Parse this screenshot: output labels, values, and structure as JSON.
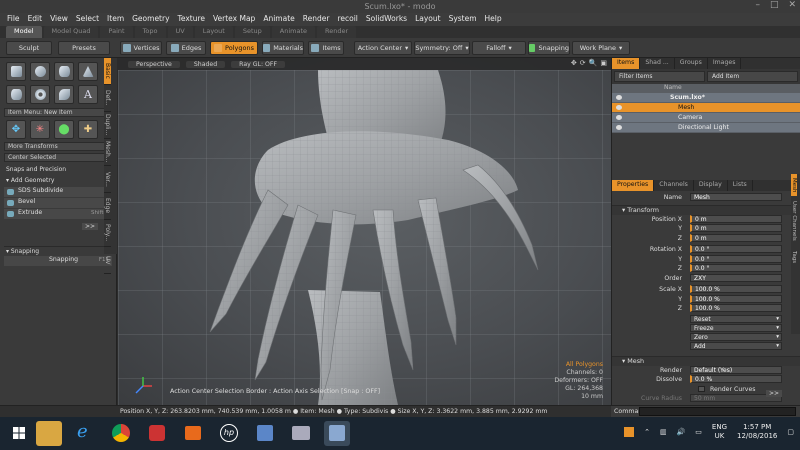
{
  "window": {
    "title": "Scum.lxo* - modo",
    "controls": [
      "–",
      "□",
      "✕"
    ]
  },
  "menu": [
    "File",
    "Edit",
    "View",
    "Select",
    "Item",
    "Geometry",
    "Texture",
    "Vertex Map",
    "Animate",
    "Render",
    "recoil",
    "SolidWorks",
    "Layout",
    "System",
    "Help"
  ],
  "layout_tabs": [
    "Model",
    "Model Quad",
    "Paint",
    "Topo",
    "UV",
    "Layout",
    "Setup",
    "Animate",
    "Render"
  ],
  "toolbar": {
    "sculpt": "Sculpt",
    "presets": "Presets",
    "vertices": "Vertices",
    "edges": "Edges",
    "polygons": "Polygons",
    "materials": "Materials",
    "items": "Items",
    "action_center": "Action Center",
    "symmetry": "Symmetry: Off",
    "falloff": "Falloff",
    "snapping": "Snapping",
    "work_plane": "Work Plane"
  },
  "left": {
    "item_menu": "Item Menu: New Item",
    "more_transforms": "More Transforms",
    "center_selected": "Center Selected",
    "snaps_section": "Snaps and Precision",
    "add_geometry": "Add Geometry",
    "items": [
      {
        "label": "SDS Subdivide",
        "shortcut": "D"
      },
      {
        "label": "Bevel",
        "shortcut": "B"
      },
      {
        "label": "Extrude",
        "shortcut": "Shift-X"
      }
    ],
    "more": ">>",
    "snapping_title": "Snapping",
    "snapping_btn": "Snapping",
    "snapping_key": "F11",
    "side_tabs": [
      "Basic",
      "Def...",
      "Dupli...",
      "Mesh...",
      "Ver...",
      "Edge",
      "Poly...",
      "UV"
    ]
  },
  "viewport": {
    "tabs": [
      "Perspective",
      "Shaded",
      "Ray GL: OFF"
    ],
    "hint": "Action Center Selection Border : Action Axis Selection  [Snap : OFF]",
    "status": {
      "mode": "All Polygons",
      "channels": "Channels: 0",
      "deformers": "Deformers: OFF",
      "gl": "GL: 264,368",
      "scale": "10 mm"
    }
  },
  "items_panel": {
    "tabs": [
      "Items",
      "Shad ...",
      "Groups",
      "Images"
    ],
    "filter": "Filter Items",
    "add_item": "Add Item",
    "header": "Name",
    "tree": [
      "Scum.lxo*",
      "Mesh",
      "Camera",
      "Directional Light"
    ]
  },
  "props_panel": {
    "tabs": [
      "Properties",
      "Channels",
      "Display",
      "Lists"
    ],
    "name_label": "Name",
    "name_value": "Mesh",
    "transform_title": "Transform",
    "position": {
      "label": "Position X",
      "y": "Y",
      "z": "Z",
      "x_val": "0 m",
      "y_val": "0 m",
      "z_val": "0 m"
    },
    "rotation": {
      "label": "Rotation X",
      "x_val": "0.0 °",
      "y_val": "0.0 °",
      "z_val": "0.0 °"
    },
    "order": {
      "label": "Order",
      "value": "ZXY"
    },
    "scale": {
      "label": "Scale X",
      "x_val": "100.0 %",
      "y_val": "100.0 %",
      "z_val": "100.0 %"
    },
    "actions": [
      "Reset",
      "Freeze",
      "Zero",
      "Add"
    ],
    "mesh_title": "Mesh",
    "render": {
      "label": "Render",
      "value": "Default (Yes)"
    },
    "dissolve": {
      "label": "Dissolve",
      "value": "0.0 %"
    },
    "render_curves": "Render Curves",
    "curve_radius": {
      "label": "Curve Radius",
      "value": "50 mm"
    },
    "more": ">>",
    "side_tabs": [
      "Mesh",
      "User Channels",
      "Tags"
    ]
  },
  "statusbar": "Position X, Y, Z:  263.8203 mm, 740.539 mm, 1.0058 m  ●  Item:  Mesh  ●  Type:  Subdivis  ●  Size X, Y, Z:  3.3622 mm, 3.885 mm, 2.9292 mm",
  "command": {
    "label": "Command"
  },
  "taskbar": {
    "lang": "ENG",
    "region": "UK",
    "time": "1:57 PM",
    "date": "12/08/2016"
  }
}
